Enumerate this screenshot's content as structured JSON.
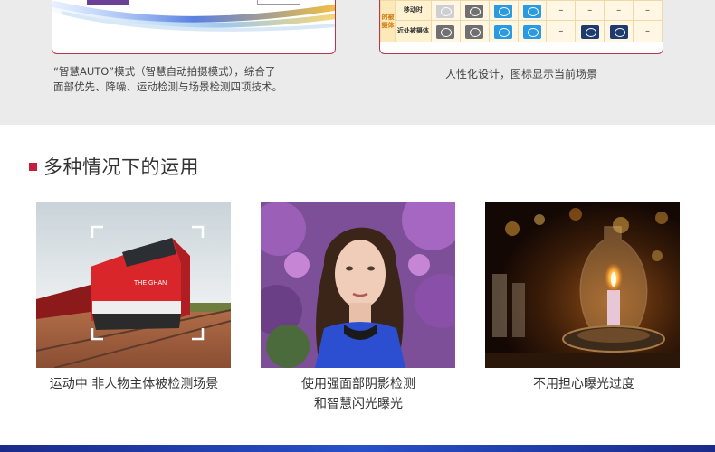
{
  "top": {
    "left_caption_line1": "“智慧AUTO”模式（智慧自动拍摄模式），综合了",
    "left_caption_line2": "面部优先、降噪、运动检测与场景检测四项技术。",
    "right_caption": "人性化设计，图标显示当前场景",
    "table": {
      "side_label_1": "的被摄体",
      "side_label_2": "",
      "row1_label": "移动时",
      "row2_label": "近处被摄体",
      "dash": "–",
      "row1_icons": [
        "scene-icon-gray",
        "scene-icon-dark",
        "scene-icon-blue",
        "scene-icon-blue-2"
      ],
      "row2_icons": [
        "macro-icon-dark",
        "macro-icon-dark-2",
        "macro-icon-blue",
        "macro-icon-blue-2"
      ],
      "row2_right_icons": [
        "backlight-macro-icon",
        "night-macro-icon"
      ]
    }
  },
  "section": {
    "title": "多种情况下的运用"
  },
  "photos": [
    {
      "caption_line1": "运动中 非人物主体被检测场景",
      "caption_line2": "",
      "train_text": "THE GHAN"
    },
    {
      "caption_line1": "使用强面部阴影检测",
      "caption_line2": "和智慧闪光曝光"
    },
    {
      "caption_line1": "不用担心曝光过度",
      "caption_line2": ""
    }
  ],
  "colors": {
    "accent": "#c4203c",
    "card_border": "#b9354e",
    "band": "#ebebeb",
    "footer": "#2750c9"
  }
}
